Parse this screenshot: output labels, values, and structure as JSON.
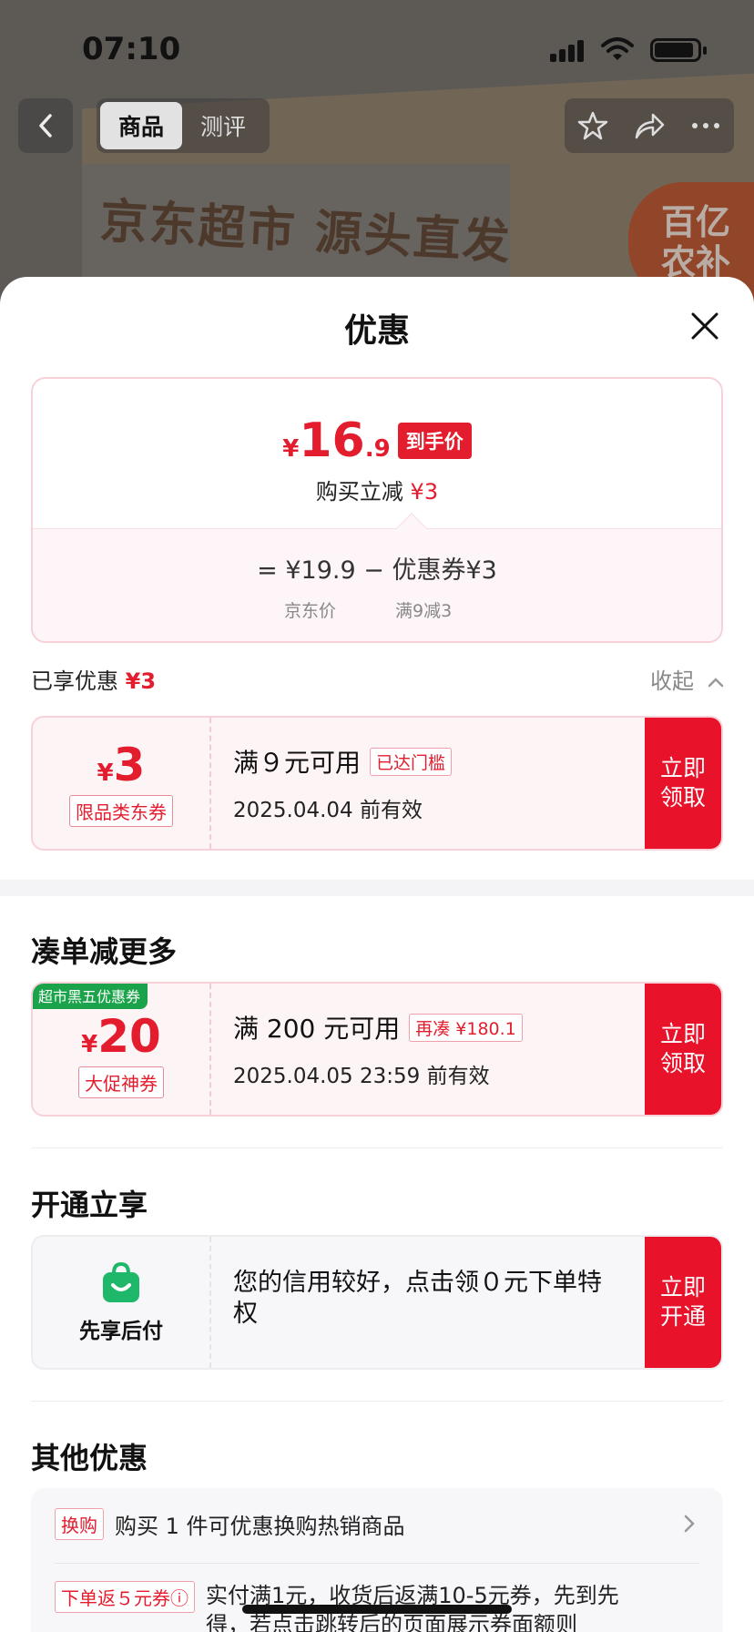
{
  "status_bar": {
    "time": "07:10"
  },
  "nav": {
    "tabs": [
      {
        "label": "商品"
      },
      {
        "label": "测评"
      }
    ]
  },
  "background": {
    "box_text": "京东超市 源头直发",
    "badge_text": "百亿农补"
  },
  "sheet": {
    "title": "优惠",
    "price_summary": {
      "currency": "¥",
      "price_int": "16",
      "price_dec": ".9",
      "price_badge": "到手价",
      "instant_label": "购买立减",
      "instant_amount": "¥3",
      "formula": "= ¥19.9 − 优惠券¥3",
      "jd_price_label": "京东价",
      "coupon_rule": "满9减3"
    },
    "enjoyed": {
      "label": "已享优惠",
      "amount": "¥3",
      "collapse": "收起"
    },
    "coupons": [
      {
        "currency": "¥",
        "amount": "3",
        "type": "限品类东券",
        "condition": "满９元可用",
        "tag": "已达门槛",
        "expiry": "2025.04.04 前有效",
        "button": "立即领取"
      }
    ],
    "more_section": {
      "title": "凑单减更多",
      "coupon": {
        "ribbon": "超市黑五优惠券",
        "currency": "¥",
        "amount": "20",
        "type": "大促神券",
        "condition": "满 200 元可用",
        "tag": "再凑 ¥180.1",
        "expiry": "2025.04.05 23:59 前有效",
        "button": "立即领取"
      }
    },
    "open_section": {
      "title": "开通立享",
      "pay_label": "先享后付",
      "text": "您的信用较好，点击领０元下单特权",
      "button": "立即开通"
    },
    "other_section": {
      "title": "其他优惠",
      "items": [
        {
          "tag": "换购",
          "text": "购买 1 件可优惠换购热销商品"
        },
        {
          "tag": "下单返５元券ⓘ",
          "text": "实付满1元，收货后返满10-5元券，先到先得，若点击跳转后的页面展示券面额则"
        }
      ]
    }
  },
  "colors": {
    "accent": "#e31d2e",
    "button": "#e8132b",
    "green": "#1aa34a"
  }
}
